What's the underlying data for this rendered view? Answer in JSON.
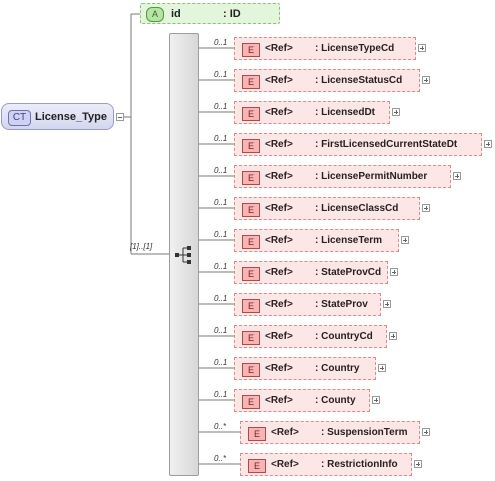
{
  "complex_type": {
    "badge": "CT",
    "name": "License_Type"
  },
  "attribute": {
    "badge": "A",
    "name": "id",
    "type": ": ID"
  },
  "sequence": {
    "cardinality": "[1]..[1]"
  },
  "elements": [
    {
      "badge": "E",
      "ref": "<Ref>",
      "name": ": LicenseTypeCd",
      "card": "0..1"
    },
    {
      "badge": "E",
      "ref": "<Ref>",
      "name": ": LicenseStatusCd",
      "card": "0..1"
    },
    {
      "badge": "E",
      "ref": "<Ref>",
      "name": ": LicensedDt",
      "card": "0..1"
    },
    {
      "badge": "E",
      "ref": "<Ref>",
      "name": ": FirstLicensedCurrentStateDt",
      "card": "0..1"
    },
    {
      "badge": "E",
      "ref": "<Ref>",
      "name": ": LicensePermitNumber",
      "card": "0..1"
    },
    {
      "badge": "E",
      "ref": "<Ref>",
      "name": ": LicenseClassCd",
      "card": "0..1"
    },
    {
      "badge": "E",
      "ref": "<Ref>",
      "name": ": LicenseTerm",
      "card": "0..1"
    },
    {
      "badge": "E",
      "ref": "<Ref>",
      "name": ": StateProvCd",
      "card": "0..1"
    },
    {
      "badge": "E",
      "ref": "<Ref>",
      "name": ": StateProv",
      "card": "0..1"
    },
    {
      "badge": "E",
      "ref": "<Ref>",
      "name": ": CountryCd",
      "card": "0..1"
    },
    {
      "badge": "E",
      "ref": "<Ref>",
      "name": ": Country",
      "card": "0..1"
    },
    {
      "badge": "E",
      "ref": "<Ref>",
      "name": ": County",
      "card": "0..1"
    },
    {
      "badge": "E",
      "ref": "<Ref>",
      "name": ": SuspensionTerm",
      "card": "0..*"
    },
    {
      "badge": "E",
      "ref": "<Ref>",
      "name": ": RestrictionInfo",
      "card": "0..*"
    }
  ]
}
